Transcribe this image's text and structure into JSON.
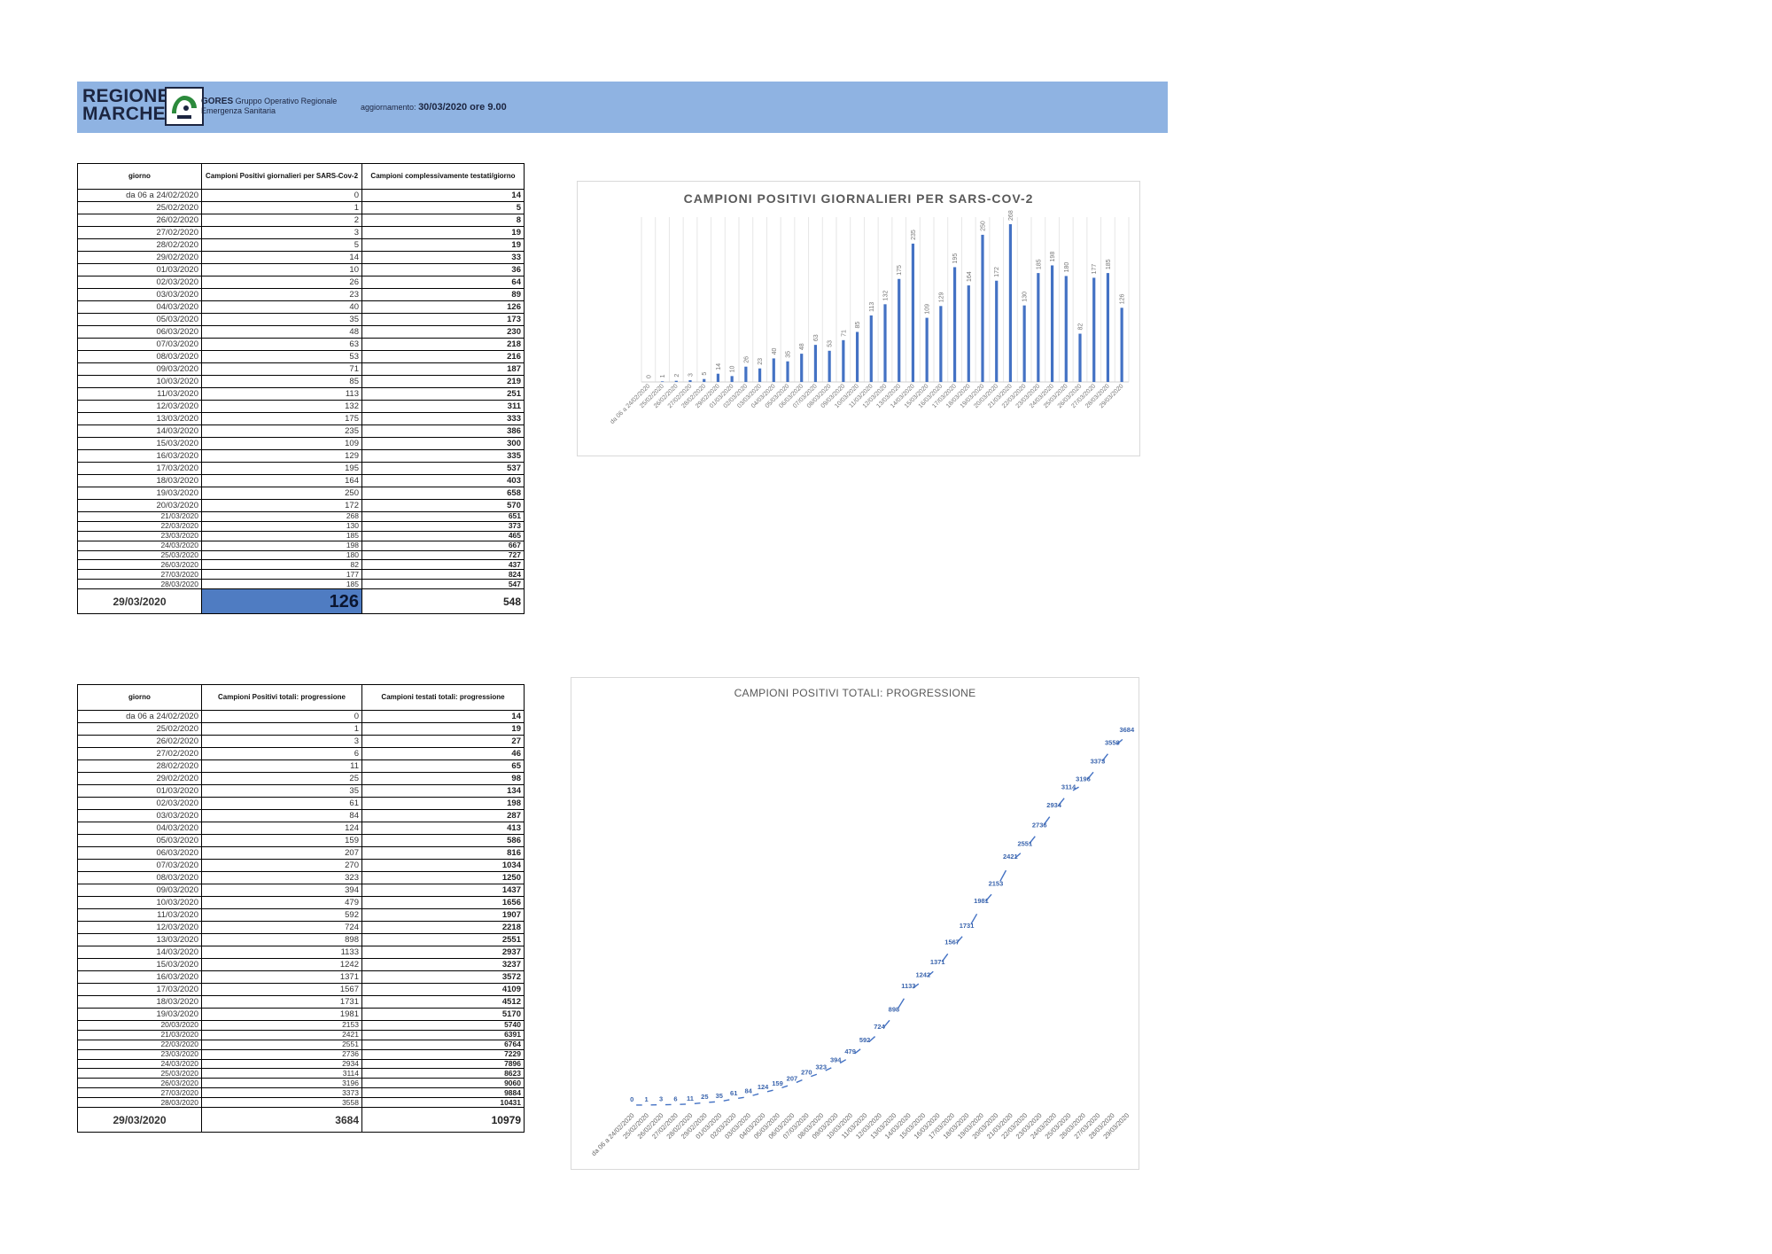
{
  "header": {
    "logo_line1": "REGIONE",
    "logo_line2": "MARCHE",
    "org_name": "GORES",
    "org_desc_1": "Gruppo Operativo Regionale",
    "org_desc_2": "Emergenza Sanitaria",
    "update_label": "aggiornamento:",
    "update_value": "30/03/2020 ore 9.00",
    "banner_color": "#8fb3e2"
  },
  "table1": {
    "headers": [
      "giorno",
      "Campioni Positivi giornalieri per SARS-Cov-2",
      "Campioni complessivamente testati/giorno"
    ],
    "rows": [
      [
        "da 06 a 24/02/2020",
        "0",
        "14"
      ],
      [
        "25/02/2020",
        "1",
        "5"
      ],
      [
        "26/02/2020",
        "2",
        "8"
      ],
      [
        "27/02/2020",
        "3",
        "19"
      ],
      [
        "28/02/2020",
        "5",
        "19"
      ],
      [
        "29/02/2020",
        "14",
        "33"
      ],
      [
        "01/03/2020",
        "10",
        "36"
      ],
      [
        "02/03/2020",
        "26",
        "64"
      ],
      [
        "03/03/2020",
        "23",
        "89"
      ],
      [
        "04/03/2020",
        "40",
        "126"
      ],
      [
        "05/03/2020",
        "35",
        "173"
      ],
      [
        "06/03/2020",
        "48",
        "230"
      ],
      [
        "07/03/2020",
        "63",
        "218"
      ],
      [
        "08/03/2020",
        "53",
        "216"
      ],
      [
        "09/03/2020",
        "71",
        "187"
      ],
      [
        "10/03/2020",
        "85",
        "219"
      ],
      [
        "11/03/2020",
        "113",
        "251"
      ],
      [
        "12/03/2020",
        "132",
        "311"
      ],
      [
        "13/03/2020",
        "175",
        "333"
      ],
      [
        "14/03/2020",
        "235",
        "386"
      ],
      [
        "15/03/2020",
        "109",
        "300"
      ],
      [
        "16/03/2020",
        "129",
        "335"
      ],
      [
        "17/03/2020",
        "195",
        "537"
      ],
      [
        "18/03/2020",
        "164",
        "403"
      ],
      [
        "19/03/2020",
        "250",
        "658"
      ],
      [
        "20/03/2020",
        "172",
        "570"
      ],
      [
        "21/03/2020",
        "268",
        "651"
      ],
      [
        "22/03/2020",
        "130",
        "373"
      ],
      [
        "23/03/2020",
        "185",
        "465"
      ],
      [
        "24/03/2020",
        "198",
        "667"
      ],
      [
        "25/03/2020",
        "180",
        "727"
      ],
      [
        "26/03/2020",
        "82",
        "437"
      ],
      [
        "27/03/2020",
        "177",
        "824"
      ],
      [
        "28/03/2020",
        "185",
        "547"
      ]
    ],
    "total": [
      "29/03/2020",
      "126",
      "548"
    ],
    "highlight_color": "#4f7cc2"
  },
  "table2": {
    "headers": [
      "giorno",
      "Campioni Positivi totali: progressione",
      "Campioni testati totali: progressione"
    ],
    "rows": [
      [
        "da 06 a 24/02/2020",
        "0",
        "14"
      ],
      [
        "25/02/2020",
        "1",
        "19"
      ],
      [
        "26/02/2020",
        "3",
        "27"
      ],
      [
        "27/02/2020",
        "6",
        "46"
      ],
      [
        "28/02/2020",
        "11",
        "65"
      ],
      [
        "29/02/2020",
        "25",
        "98"
      ],
      [
        "01/03/2020",
        "35",
        "134"
      ],
      [
        "02/03/2020",
        "61",
        "198"
      ],
      [
        "03/03/2020",
        "84",
        "287"
      ],
      [
        "04/03/2020",
        "124",
        "413"
      ],
      [
        "05/03/2020",
        "159",
        "586"
      ],
      [
        "06/03/2020",
        "207",
        "816"
      ],
      [
        "07/03/2020",
        "270",
        "1034"
      ],
      [
        "08/03/2020",
        "323",
        "1250"
      ],
      [
        "09/03/2020",
        "394",
        "1437"
      ],
      [
        "10/03/2020",
        "479",
        "1656"
      ],
      [
        "11/03/2020",
        "592",
        "1907"
      ],
      [
        "12/03/2020",
        "724",
        "2218"
      ],
      [
        "13/03/2020",
        "898",
        "2551"
      ],
      [
        "14/03/2020",
        "1133",
        "2937"
      ],
      [
        "15/03/2020",
        "1242",
        "3237"
      ],
      [
        "16/03/2020",
        "1371",
        "3572"
      ],
      [
        "17/03/2020",
        "1567",
        "4109"
      ],
      [
        "18/03/2020",
        "1731",
        "4512"
      ],
      [
        "19/03/2020",
        "1981",
        "5170"
      ],
      [
        "20/03/2020",
        "2153",
        "5740"
      ],
      [
        "21/03/2020",
        "2421",
        "6391"
      ],
      [
        "22/03/2020",
        "2551",
        "6764"
      ],
      [
        "23/03/2020",
        "2736",
        "7229"
      ],
      [
        "24/03/2020",
        "2934",
        "7896"
      ],
      [
        "25/03/2020",
        "3114",
        "8623"
      ],
      [
        "26/03/2020",
        "3196",
        "9060"
      ],
      [
        "27/03/2020",
        "3373",
        "9884"
      ],
      [
        "28/03/2020",
        "3558",
        "10431"
      ]
    ],
    "total": [
      "29/03/2020",
      "3684",
      "10979"
    ]
  },
  "chart_data": [
    {
      "type": "bar",
      "title": "CAMPIONI POSITIVI GIORNALIERI PER SARS-COV-2",
      "categories": [
        "da 06 a 24/02/2020",
        "25/02/2020",
        "26/02/2020",
        "27/02/2020",
        "28/02/2020",
        "29/02/2020",
        "01/03/2020",
        "02/03/2020",
        "03/03/2020",
        "04/03/2020",
        "05/03/2020",
        "06/03/2020",
        "07/03/2020",
        "08/03/2020",
        "09/03/2020",
        "10/03/2020",
        "11/03/2020",
        "12/03/2020",
        "13/03/2020",
        "14/03/2020",
        "15/03/2020",
        "16/03/2020",
        "17/03/2020",
        "18/03/2020",
        "19/03/2020",
        "20/03/2020",
        "21/03/2020",
        "22/03/2020",
        "23/03/2020",
        "24/03/2020",
        "25/03/2020",
        "26/03/2020",
        "27/03/2020",
        "28/03/2020",
        "29/03/2020"
      ],
      "values": [
        0,
        1,
        2,
        3,
        5,
        14,
        10,
        26,
        23,
        40,
        35,
        48,
        63,
        53,
        71,
        85,
        113,
        132,
        175,
        235,
        109,
        129,
        195,
        164,
        250,
        172,
        268,
        130,
        185,
        198,
        180,
        82,
        177,
        185,
        126
      ],
      "ylim": [
        0,
        280
      ],
      "grid": "vertical",
      "bar_color": "#4472c4"
    },
    {
      "type": "line",
      "title": "CAMPIONI POSITIVI TOTALI: PROGRESSIONE",
      "categories": [
        "da 06 a 24/02/2020",
        "25/02/2020",
        "26/02/2020",
        "27/02/2020",
        "28/02/2020",
        "29/02/2020",
        "01/03/2020",
        "02/03/2020",
        "03/03/2020",
        "04/03/2020",
        "05/03/2020",
        "06/03/2020",
        "07/03/2020",
        "08/03/2020",
        "09/03/2020",
        "10/03/2020",
        "11/03/2020",
        "12/03/2020",
        "13/03/2020",
        "14/03/2020",
        "15/03/2020",
        "16/03/2020",
        "17/03/2020",
        "18/03/2020",
        "19/03/2020",
        "20/03/2020",
        "21/03/2020",
        "22/03/2020",
        "23/03/2020",
        "24/03/2020",
        "25/03/2020",
        "26/03/2020",
        "27/03/2020",
        "28/03/2020",
        "29/03/2020"
      ],
      "values": [
        0,
        1,
        3,
        6,
        11,
        25,
        35,
        61,
        84,
        124,
        159,
        207,
        270,
        323,
        394,
        479,
        592,
        724,
        898,
        1133,
        1242,
        1371,
        1567,
        1731,
        1981,
        2153,
        2421,
        2551,
        2736,
        2934,
        3114,
        3196,
        3373,
        3558,
        3684
      ],
      "ylim": [
        0,
        3800
      ],
      "line_color": "#4472c4"
    }
  ]
}
